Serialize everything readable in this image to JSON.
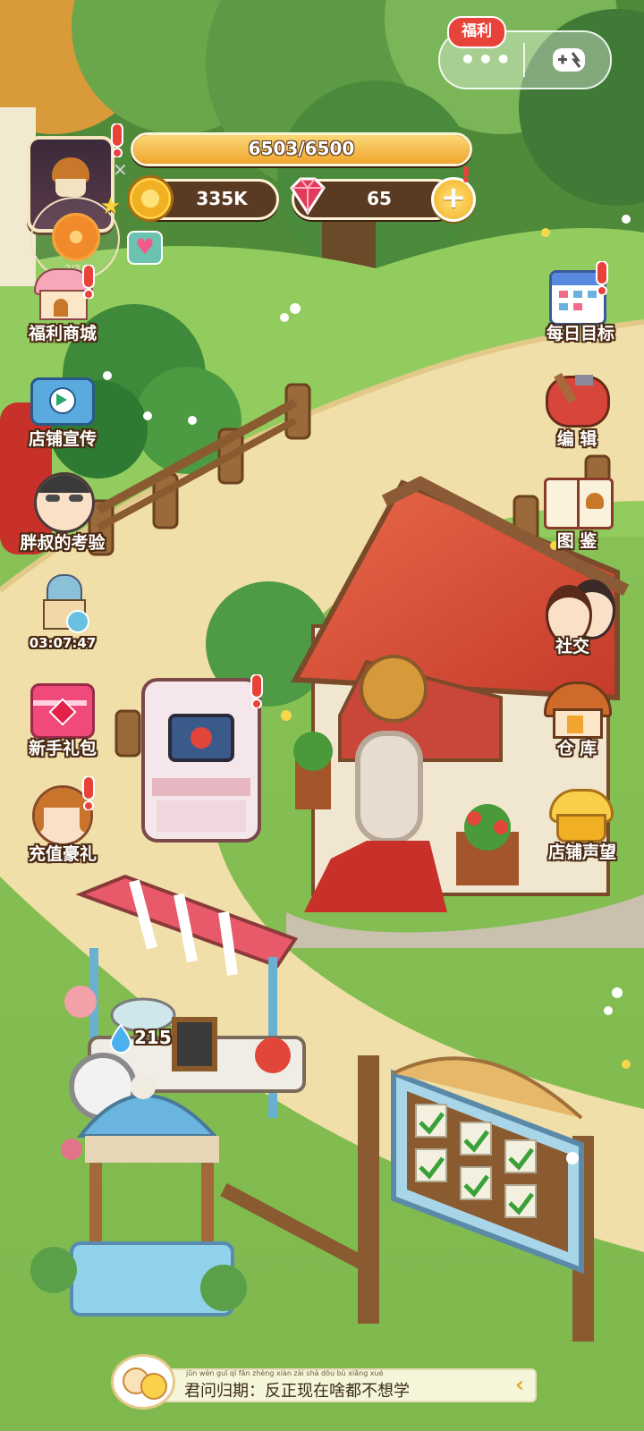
{
  "capsule": {
    "badge": "福利"
  },
  "resources": {
    "exp": "6503/6500",
    "exp_fill": 1.0,
    "gold": "335K",
    "gems": "65",
    "avatar_counter": "2/3"
  },
  "left_menu": [
    {
      "label": "福利商城"
    },
    {
      "label": "店铺宣传"
    },
    {
      "label": "胖叔的考验"
    },
    {
      "label": "03:07:47"
    },
    {
      "label": "新手礼包"
    },
    {
      "label": "充值豪礼"
    }
  ],
  "right_menu": [
    {
      "label": "每日目标"
    },
    {
      "label": "编 辑"
    },
    {
      "label": "图 鉴"
    },
    {
      "label": "社交"
    },
    {
      "label": "仓 库"
    },
    {
      "label": "店铺声望"
    }
  ],
  "water": {
    "value": "215"
  },
  "subtitle": {
    "text": "君问归期：反正现在啥都不想学",
    "pinyin": "jūn wèn guī qī   fǎn zhèng xiàn zài shá dōu bù xiǎng xué"
  },
  "colors": {
    "accent_red": "#e8433a",
    "gold": "#f6c54a",
    "bar_brown": "#5a3a22"
  }
}
